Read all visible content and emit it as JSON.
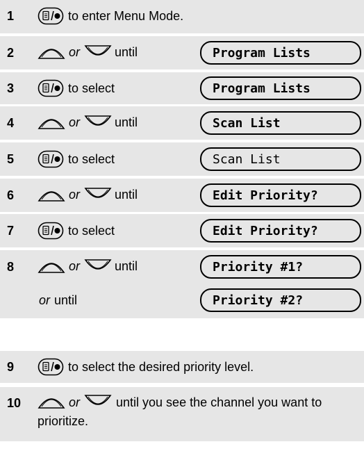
{
  "steps": [
    {
      "num": "1",
      "text": "to enter Menu Mode."
    },
    {
      "num": "2",
      "or": "or",
      "text": "until",
      "display": "Program Lists"
    },
    {
      "num": "3",
      "text": "to select",
      "display": "Program Lists"
    },
    {
      "num": "4",
      "or": "or",
      "text": "until",
      "display": "Scan List"
    },
    {
      "num": "5",
      "text": "to select",
      "display": "Scan List"
    },
    {
      "num": "6",
      "or": "or",
      "text": "until",
      "display": "Edit Priority?"
    },
    {
      "num": "7",
      "text": "to select",
      "display": "Edit Priority?"
    },
    {
      "num": "8",
      "or": "or",
      "text": "until",
      "display": "Priority #1?"
    },
    {
      "or": "or",
      "text": "until",
      "display": "Priority #2?"
    },
    {
      "num": "9",
      "text": "to select the desired priority level."
    },
    {
      "num": "10",
      "or": "or",
      "text": "until you see the channel you want to prioritize."
    }
  ],
  "icons": {
    "menu_select": "menu-select-button-icon",
    "up": "up-arrow-button-icon",
    "down": "down-arrow-button-icon"
  },
  "colors": {
    "band": "#e6e6e6",
    "ink": "#000000"
  }
}
